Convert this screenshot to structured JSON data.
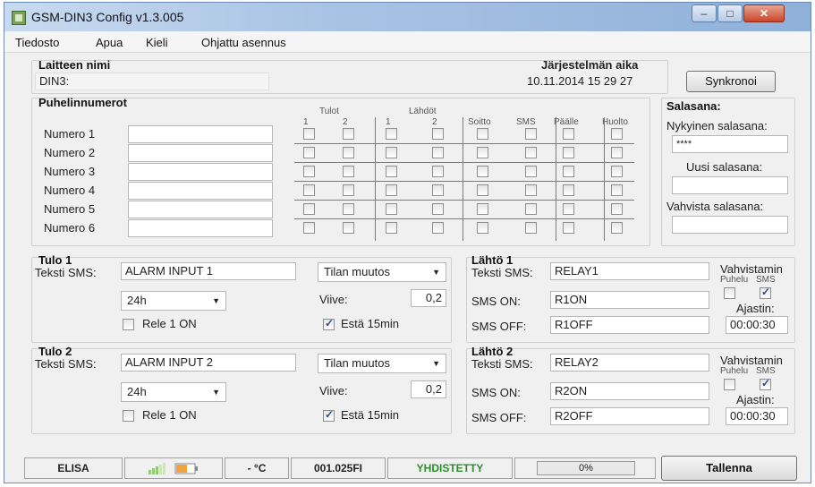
{
  "window": {
    "title": "GSM-DIN3 Config v1.3.005"
  },
  "menu": [
    "Tiedosto",
    "Apua",
    "Kieli",
    "Ohjattu asennus"
  ],
  "device": {
    "label": "Laitteen nimi",
    "value": "DIN3:"
  },
  "system_time": {
    "label": "Järjestelmän aika",
    "value": "10.11.2014 15 29 27",
    "sync_button": "Synkronoi"
  },
  "phones": {
    "title": "Puhelinnumerot",
    "group_inputs": "Tulot",
    "group_outputs": "Lähdöt",
    "col_labels": [
      "1",
      "2",
      "1",
      "2",
      "Soitto",
      "SMS",
      "Päälle",
      "Huolto"
    ],
    "rows": [
      "Numero 1",
      "Numero 2",
      "Numero 3",
      "Numero 4",
      "Numero 5",
      "Numero 6"
    ],
    "values": [
      "",
      "",
      "",
      "",
      "",
      ""
    ]
  },
  "password": {
    "title": "Salasana:",
    "current_label": "Nykyinen salasana:",
    "current_value": "****",
    "new_label": "Uusi salasana:",
    "new_value": "",
    "confirm_label": "Vahvista salasana:",
    "confirm_value": ""
  },
  "inputs": [
    {
      "title": "Tulo 1",
      "sms_label": "Teksti SMS:",
      "sms_value": "ALARM INPUT 1",
      "mode": "Tilan muutos",
      "period": "24h",
      "delay_label": "Viive:",
      "delay_value": "0,2",
      "relay_label": "Rele 1 ON",
      "relay_checked": false,
      "block_label": "Estä 15min",
      "block_checked": true
    },
    {
      "title": "Tulo 2",
      "sms_label": "Teksti SMS:",
      "sms_value": "ALARM INPUT 2",
      "mode": "Tilan muutos",
      "period": "24h",
      "delay_label": "Viive:",
      "delay_value": "0,2",
      "relay_label": "Rele 1 ON",
      "relay_checked": false,
      "block_label": "Estä 15min",
      "block_checked": true
    }
  ],
  "outputs": [
    {
      "title": "Lähtö 1",
      "sms_label": "Teksti SMS:",
      "sms_value": "RELAY1",
      "on_label": "SMS ON:",
      "on_value": "R1ON",
      "off_label": "SMS OFF:",
      "off_value": "R1OFF",
      "confirm_label": "Vahvistamin",
      "call_label": "Puhelu",
      "sms_small": "SMS",
      "call_checked": false,
      "sms_checked": true,
      "timer_label": "Ajastin:",
      "timer_value": "00:00:30"
    },
    {
      "title": "Lähtö 2",
      "sms_label": "Teksti SMS:",
      "sms_value": "RELAY2",
      "on_label": "SMS ON:",
      "on_value": "R2ON",
      "off_label": "SMS OFF:",
      "off_value": "R2OFF",
      "confirm_label": "Vahvistamin",
      "call_label": "Puhelu",
      "sms_small": "SMS",
      "call_checked": false,
      "sms_checked": true,
      "timer_label": "Ajastin:",
      "timer_value": "00:00:30"
    }
  ],
  "status": {
    "operator": "ELISA",
    "temperature": "- °C",
    "firmware": "001.025FI",
    "connection": "YHDISTETTY",
    "progress": "0%",
    "progress_fraction": 0,
    "save_button": "Tallenna",
    "connected_color": "#2e8b2e",
    "signal_icon": "signal-bars-icon",
    "battery_icon": "battery-icon"
  }
}
